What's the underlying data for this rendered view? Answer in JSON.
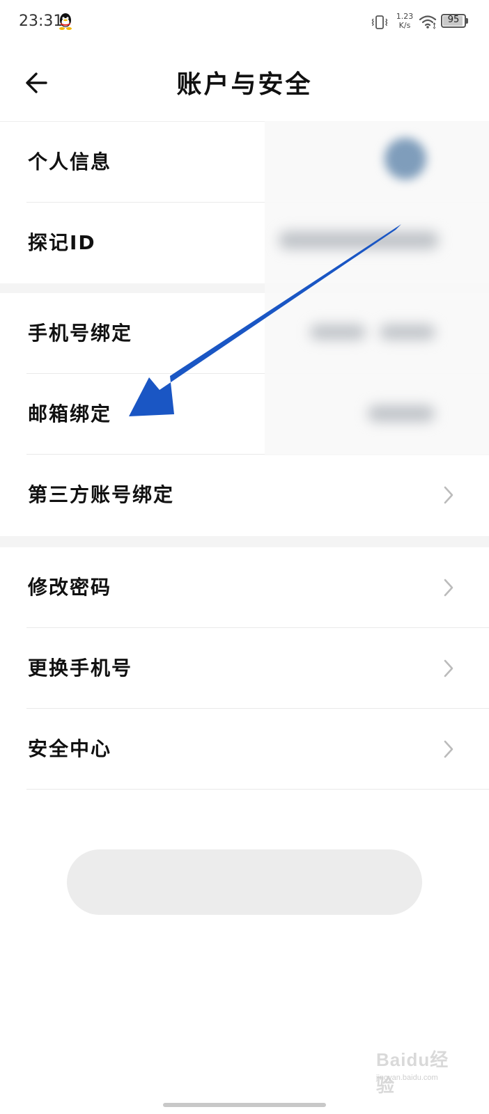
{
  "status_bar": {
    "time": "23:31",
    "net_speed_value": "1.23",
    "net_speed_unit": "K/s",
    "battery_level": "95",
    "icons": [
      "qq-icon",
      "vibrate-icon",
      "wifi-icon",
      "battery-icon"
    ]
  },
  "header": {
    "title": "账户与安全",
    "back_icon": "back-arrow-icon"
  },
  "group1": {
    "items": [
      {
        "label": "个人信息"
      },
      {
        "label": "探记ID"
      }
    ]
  },
  "group2": {
    "items": [
      {
        "label": "手机号绑定"
      },
      {
        "label": "邮箱绑定"
      },
      {
        "label": "第三方账号绑定"
      }
    ]
  },
  "group3": {
    "items": [
      {
        "label": "修改密码"
      },
      {
        "label": "更换手机号"
      },
      {
        "label": "安全中心"
      }
    ]
  },
  "bottom_button": {
    "label": ""
  },
  "annotation": {
    "type": "arrow",
    "color": "#1a56c4",
    "points_to": "邮箱绑定"
  },
  "watermark": {
    "main": "Baidu经验",
    "sub": "jingyan.baidu.com"
  },
  "colors": {
    "separator": "#f4f4f4",
    "divider": "#e9e9e9",
    "chevron": "#bbbbbb"
  }
}
